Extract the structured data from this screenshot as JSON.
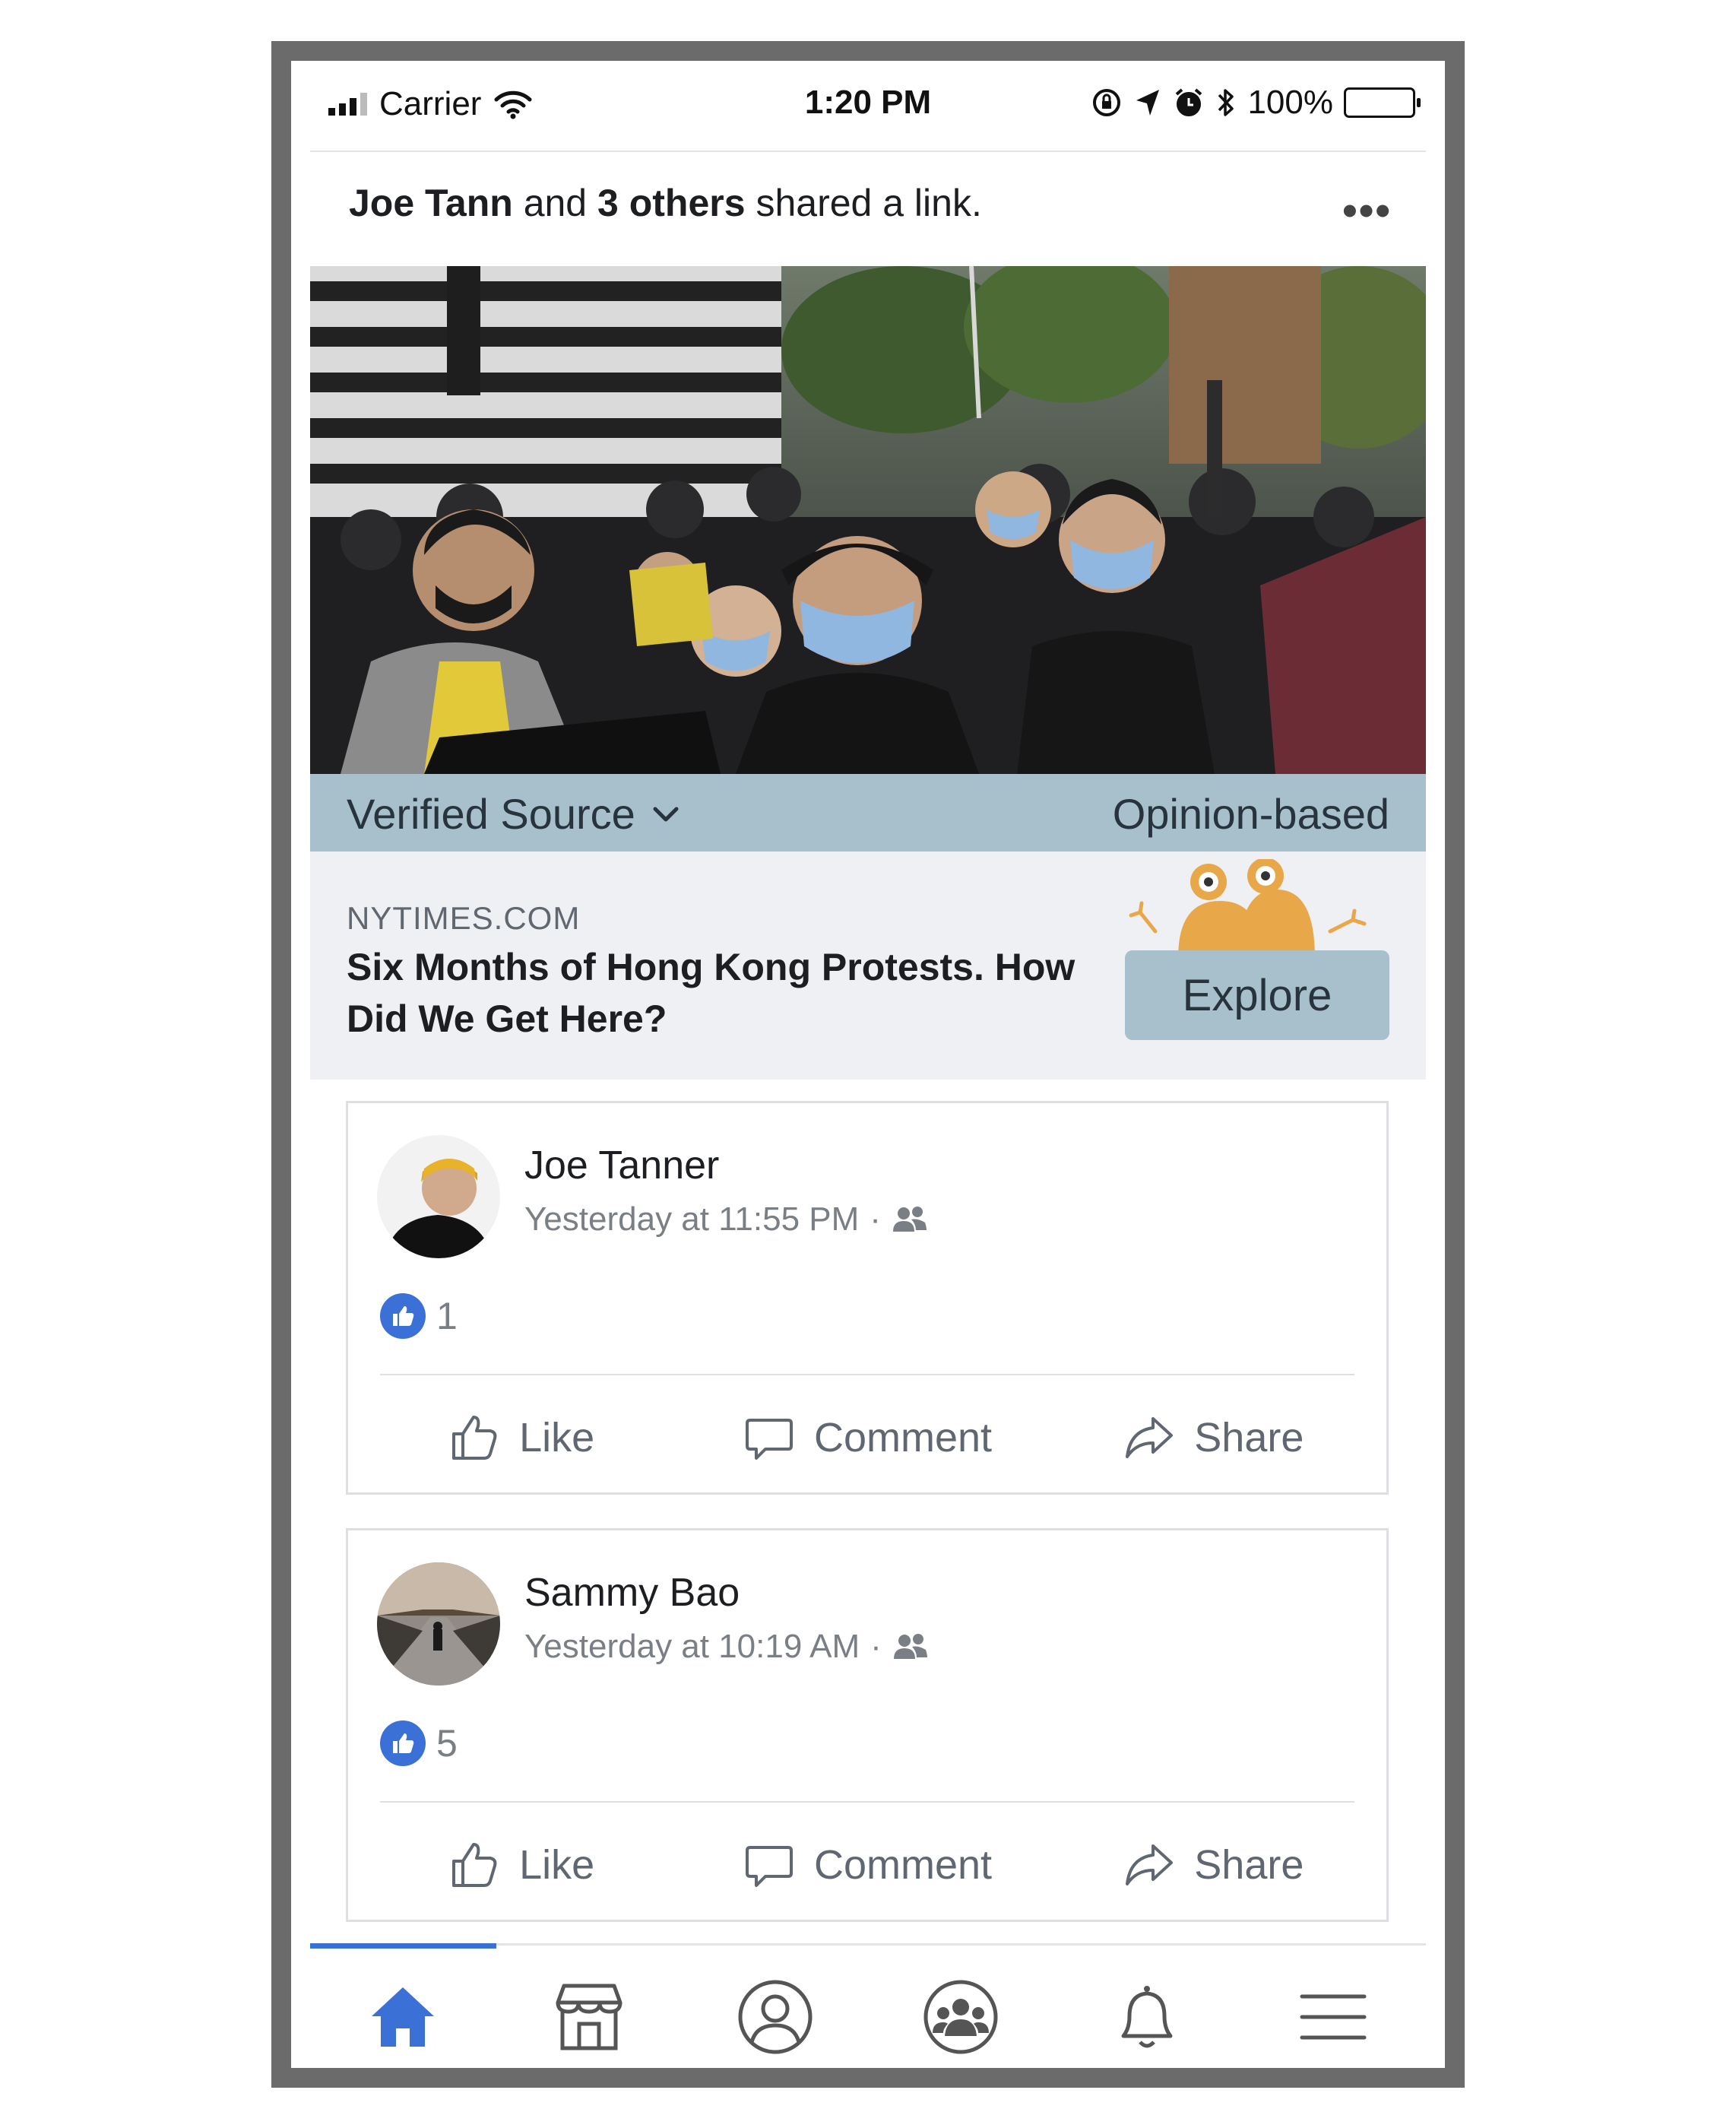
{
  "status_bar": {
    "carrier": "Carrier",
    "time": "1:20 PM",
    "battery": "100%",
    "battery_level": 1.0
  },
  "share_header": {
    "actor": "Joe Tann",
    "middle": "and",
    "others": "3 others",
    "action": "shared a link.",
    "more_label": "•••"
  },
  "link_card": {
    "verified_label": "Verified Source",
    "opinion_label": "Opinion-based",
    "domain": "NYTIMES.COM",
    "title": "Six Months of Hong Kong Protests. How Did We Get Here?",
    "explore_label": "Explore"
  },
  "comments": [
    {
      "author": "Joe Tanner",
      "timestamp": "Yesterday at 11:55 PM",
      "separator": "·",
      "like_count": "1",
      "actions": {
        "like": "Like",
        "comment": "Comment",
        "share": "Share"
      }
    },
    {
      "author": "Sammy Bao",
      "timestamp": "Yesterday at 10:19 AM",
      "separator": "·",
      "like_count": "5",
      "actions": {
        "like": "Like",
        "comment": "Comment",
        "share": "Share"
      }
    }
  ],
  "tab_bar": {
    "tabs": [
      "home-icon",
      "marketplace-icon",
      "profile-icon",
      "groups-icon",
      "notifications-icon",
      "menu-icon"
    ],
    "active": "home-icon"
  },
  "colors": {
    "accent": "#3b70d6",
    "verify_bar": "#a8c0cc",
    "meta_background": "#eef0f3",
    "mascot": "#e8a84a",
    "frame": "#6b6b6b"
  }
}
